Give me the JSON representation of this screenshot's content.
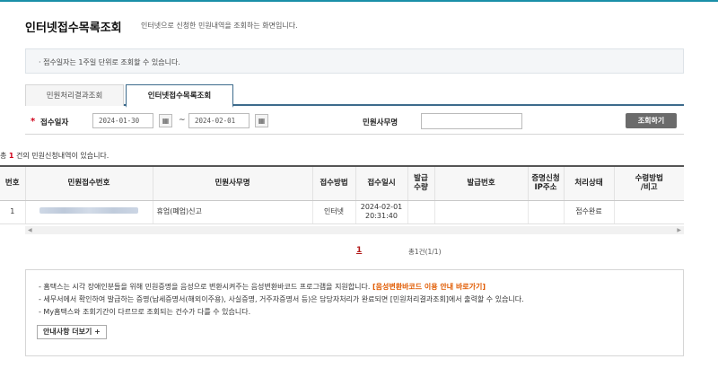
{
  "header": {
    "title": "인터넷접수목록조회",
    "description": "인터넷으로 신청한 민원내역을 조회하는 화면입니다."
  },
  "notice": {
    "text": "· 접수일자는 1주일 단위로 조회할 수 있습니다."
  },
  "tabs": [
    {
      "label": "민원처리결과조회",
      "active": false
    },
    {
      "label": "인터넷접수목록조회",
      "active": true
    }
  ],
  "search": {
    "required_mark": "*",
    "date_label": "접수일자",
    "date_from": "2024-01-30",
    "date_to": "2024-02-01",
    "range_sep": "~",
    "calendar_icon": "calendar-icon",
    "office_label": "민원사무명",
    "office_value": "",
    "button_label": "조회하기"
  },
  "result_count": {
    "prefix": "총 ",
    "count": "1",
    "suffix": " 건의 민원신청내역이 있습니다."
  },
  "table": {
    "columns": [
      "번호",
      "민원접수번호",
      "민원사무명",
      "접수방법",
      "접수일시",
      "발급\n수량",
      "발급번호",
      "증명신청\nIP주소",
      "처리상태",
      "수령방법\n/비고"
    ],
    "rows": [
      {
        "no": "1",
        "receipt_no": "",
        "office_name": "휴업(폐업)신고",
        "method": "인터넷",
        "date": "2024-02-01",
        "time": "20:31:40",
        "qty": "",
        "issue_no": "",
        "ip": "",
        "status": "접수완료",
        "remark": ""
      }
    ]
  },
  "pagination": {
    "current": "1",
    "info": "총1건(1/1)"
  },
  "guide": {
    "line1": "- 홈택스는 시각 장애인분들을 위해 민원증명을 음성으로 변환시켜주는 음성변환바코드 프로그램을 지원합니다.",
    "line1_link": "[음성변환바코드 이용 안내 바로가기]",
    "line2": "- 세무서에서 확인하여 발급하는 증명(납세증명서(해외이주용), 사실증명, 거주자증명서 등)은 담당자처리가 완료되면 [민원처리결과조회]에서 출력할 수 있습니다.",
    "line3": "- My홈택스와 조회기간이 다르므로 조회되는 건수가 다를 수 있습니다.",
    "more_button": "안내사항 더보기 +"
  }
}
